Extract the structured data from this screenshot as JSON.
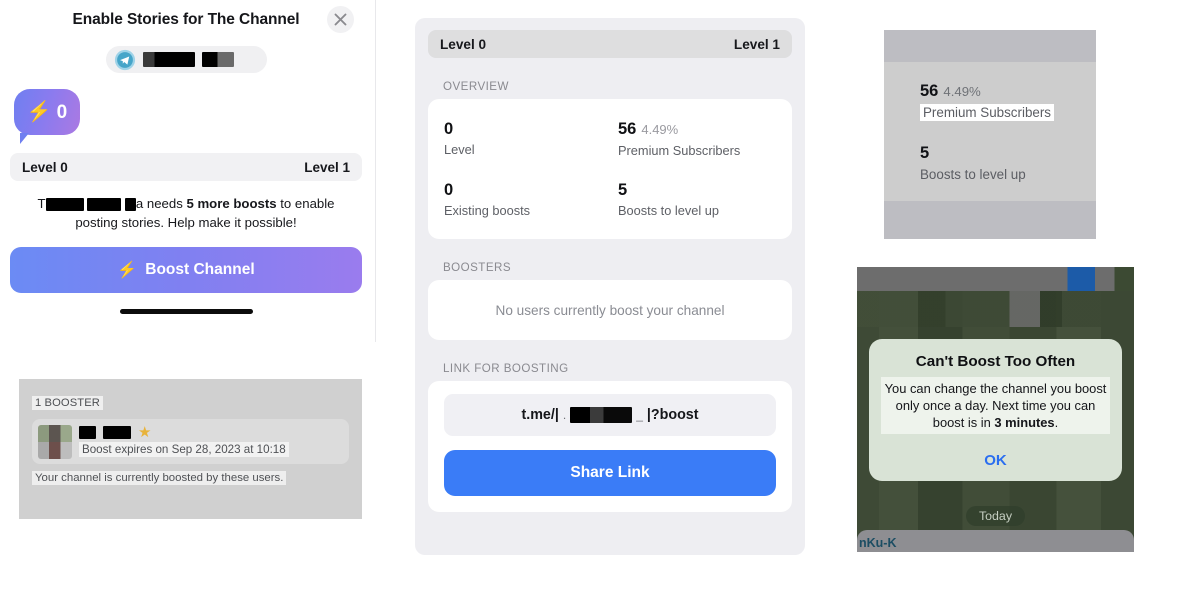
{
  "panel_a": {
    "title": "Enable Stories for The Channel",
    "close_icon": "close-icon",
    "chip": {
      "app_icon": "telegram-icon",
      "redacted": [
        "█████",
        "███"
      ]
    },
    "badge": {
      "icon": "lightning-bolt-icon",
      "count": "0"
    },
    "level_bar": {
      "current": "Level 0",
      "next": "Level 1"
    },
    "description_prefix": "T",
    "description_mid": "a needs ",
    "description_bold": "5 more boosts",
    "description_suffix": " to enable posting stories. Help make it possible!",
    "boost_button": {
      "icon": "lightning-bolt-icon",
      "label": "Boost Channel"
    }
  },
  "panel_b": {
    "header": "1 BOOSTER",
    "row": {
      "avatar": "user-avatar",
      "badge_icon": "premium-star-icon",
      "expires": "Boost expires on Sep 28, 2023 at 10:18"
    },
    "footer": "Your channel is currently boosted by these users."
  },
  "panel_c": {
    "level_bar": {
      "current": "Level 0",
      "next": "Level 1"
    },
    "overview_label": "OVERVIEW",
    "stats": [
      {
        "value": "0",
        "pct": "",
        "label": "Level"
      },
      {
        "value": "56",
        "pct": "4.49%",
        "label": "Premium Subscribers"
      },
      {
        "value": "0",
        "pct": "",
        "label": "Existing boosts"
      },
      {
        "value": "5",
        "pct": "",
        "label": "Boosts to level up"
      }
    ],
    "boosters_label": "BOOSTERS",
    "boosters_empty": "No users currently boost your channel",
    "link_label": "LINK FOR BOOSTING",
    "link_prefix": "t.me/|",
    "link_dot_left": ".",
    "link_dot_right": "_",
    "link_suffix": "|?boost",
    "share_button": "Share Link"
  },
  "panel_d": {
    "premium": {
      "value": "56",
      "pct": "4.49%",
      "label": "Premium Subscribers"
    },
    "boosts": {
      "value": "5",
      "pct": "",
      "label": "Boosts to level up"
    }
  },
  "panel_e": {
    "alert": {
      "title": "Can't Boost Too Often",
      "body_pre": "You can change the channel you boost only once a day. Next time you can boost is in ",
      "body_bold": "3 minutes",
      "body_post": ".",
      "ok_label": "OK"
    },
    "date_pill": "Today",
    "footer_text": "nKu-K"
  },
  "colors": {
    "boost_gradient_start": "#6b8bf4",
    "boost_gradient_end": "#9a7cee",
    "share_blue": "#3a7cf7",
    "ok_blue": "#2a6ef0",
    "premium_star": "#e8b33a"
  }
}
